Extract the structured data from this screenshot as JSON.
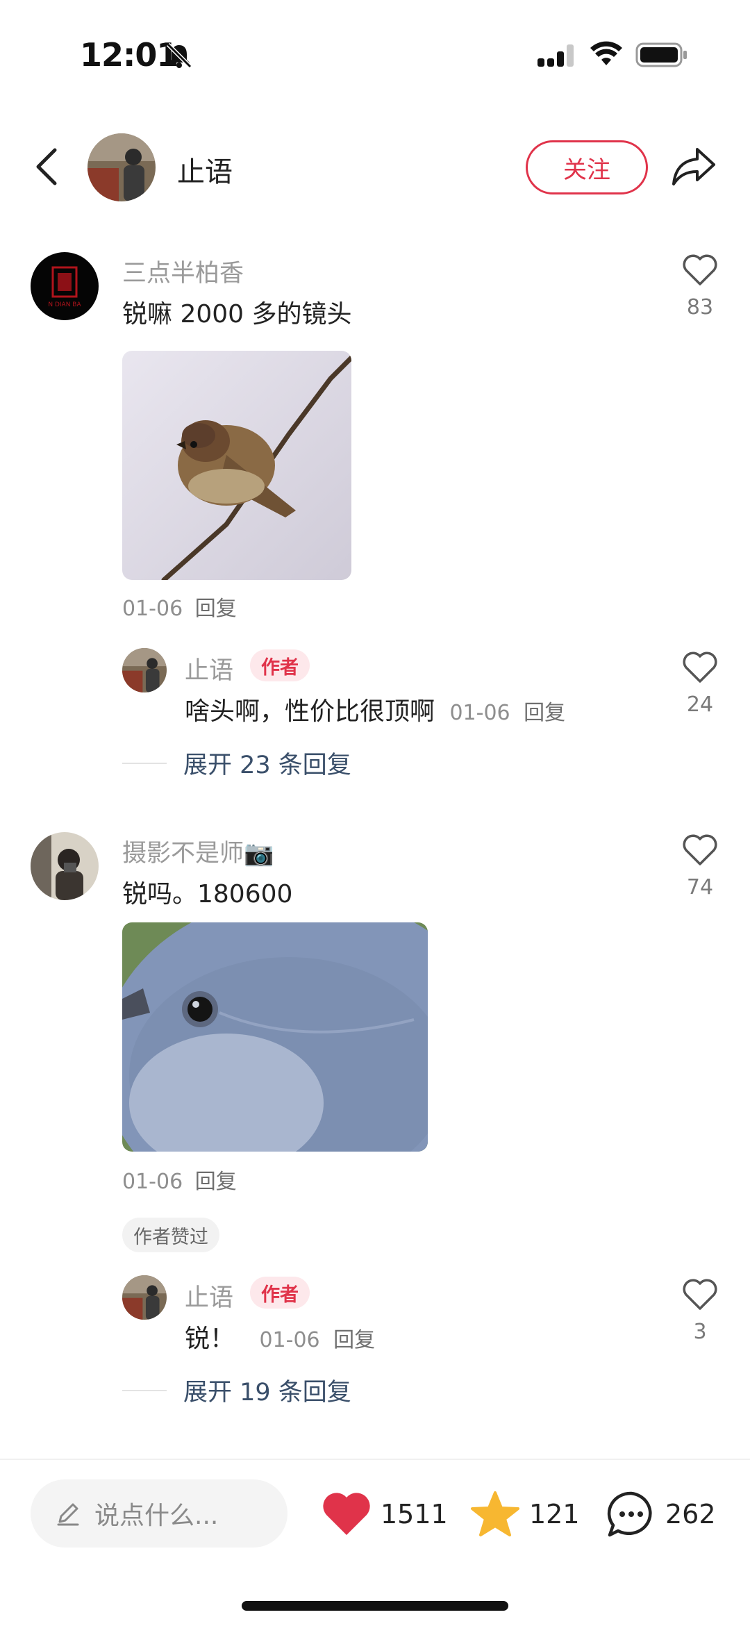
{
  "status_bar": {
    "time": "12:01"
  },
  "header": {
    "author_name": "止语",
    "follow_label": "关注"
  },
  "comments": [
    {
      "username": "三点半柏香",
      "text": "锐嘛  2000 多的镜头",
      "likes": "83",
      "date": "01-06",
      "reply_label": "回复",
      "reply": {
        "username": "止语",
        "tag": "作者",
        "text": "啥头啊，性价比很顶啊",
        "date": "01-06",
        "reply_label": "回复",
        "likes": "24"
      },
      "expand_label": "展开 23 条回复"
    },
    {
      "username": "摄影不是师📷",
      "text": "锐吗。180600",
      "likes": "74",
      "date": "01-06",
      "reply_label": "回复",
      "liked_badge": "作者赞过",
      "reply": {
        "username": "止语",
        "tag": "作者",
        "text": "锐！",
        "date": "01-06",
        "reply_label": "回复",
        "likes": "3"
      },
      "expand_label": "展开 19 条回复"
    }
  ],
  "bottom_bar": {
    "input_placeholder": "说点什么...",
    "likes": "1511",
    "favorites": "121",
    "comments": "262"
  },
  "colors": {
    "accent": "#e0334a",
    "star": "#f7b731",
    "link": "#3a4f6a"
  }
}
